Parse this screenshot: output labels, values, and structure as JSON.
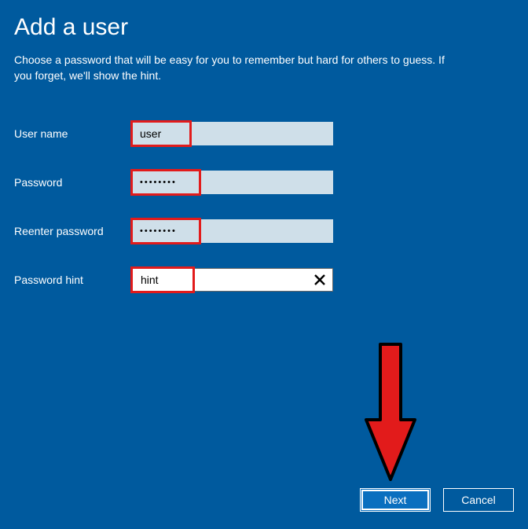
{
  "header": {
    "title": "Add a user",
    "subtitle": "Choose a password that will be easy for you to remember but hard for others to guess. If you forget, we'll show the hint."
  },
  "form": {
    "username_label": "User name",
    "username_value": "user",
    "password_label": "Password",
    "password_value": "••••••••",
    "reenter_label": "Reenter password",
    "reenter_value": "••••••••",
    "hint_label": "Password hint",
    "hint_value": "hint"
  },
  "buttons": {
    "next": "Next",
    "cancel": "Cancel"
  }
}
